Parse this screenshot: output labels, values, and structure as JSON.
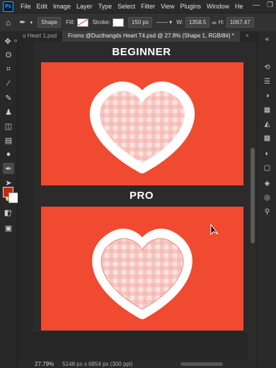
{
  "app": {
    "logo_text": "Ps"
  },
  "menu": [
    "File",
    "Edit",
    "Image",
    "Layer",
    "Type",
    "Select",
    "Filter",
    "View",
    "Plugins",
    "Window",
    "He"
  ],
  "window_controls": {
    "minimize": "—",
    "restore": "❐"
  },
  "options_bar": {
    "mode": "Shape",
    "fill_label": "Fill:",
    "stroke_label": "Stroke:",
    "stroke_width": "150 px",
    "width_label": "W:",
    "width_value": "1358.5",
    "height_label": "H:",
    "height_value": "1067.47"
  },
  "tabs": [
    {
      "label": "o Heart 1.psd",
      "active": false
    },
    {
      "label": "Froms @Ducthangds Heart T4.psd @ 27.8% (Shape 1, RGB/8#) *",
      "active": true
    },
    {
      "label": "×",
      "active": false
    }
  ],
  "canvas": {
    "section1_label": "BEGINNER",
    "section2_label": "PRO",
    "background_color": "#f04a30",
    "heart_fill": "#f9d5d0",
    "gingham_color": "#f4a8a0"
  },
  "colors": {
    "foreground": "#c32a0f",
    "background": "#ffffff"
  },
  "status": {
    "zoom": "27.79%",
    "doc_size": "5148 px x 6854 px (300 ppi)"
  },
  "left_tools": [
    "move-icon",
    "marquee-icon",
    "lasso-icon",
    "magic-wand-icon",
    "crop-icon",
    "frame-icon",
    "eyedropper-icon",
    "healing-icon",
    "brush-icon",
    "stamp-icon",
    "history-brush-icon",
    "eraser-icon",
    "gradient-icon",
    "blur-icon",
    "dodge-icon",
    "pen-icon",
    "type-icon",
    "path-select-icon",
    "shape-icon",
    "hand-icon",
    "zoom-icon",
    "more-icon"
  ],
  "right_tools": [
    "history-icon",
    "properties-icon",
    "color-icon",
    "swatches-icon",
    "libraries-icon",
    "patterns-icon",
    "adjustments-icon",
    "layers-icon",
    "channels-icon",
    "paths-icon"
  ]
}
